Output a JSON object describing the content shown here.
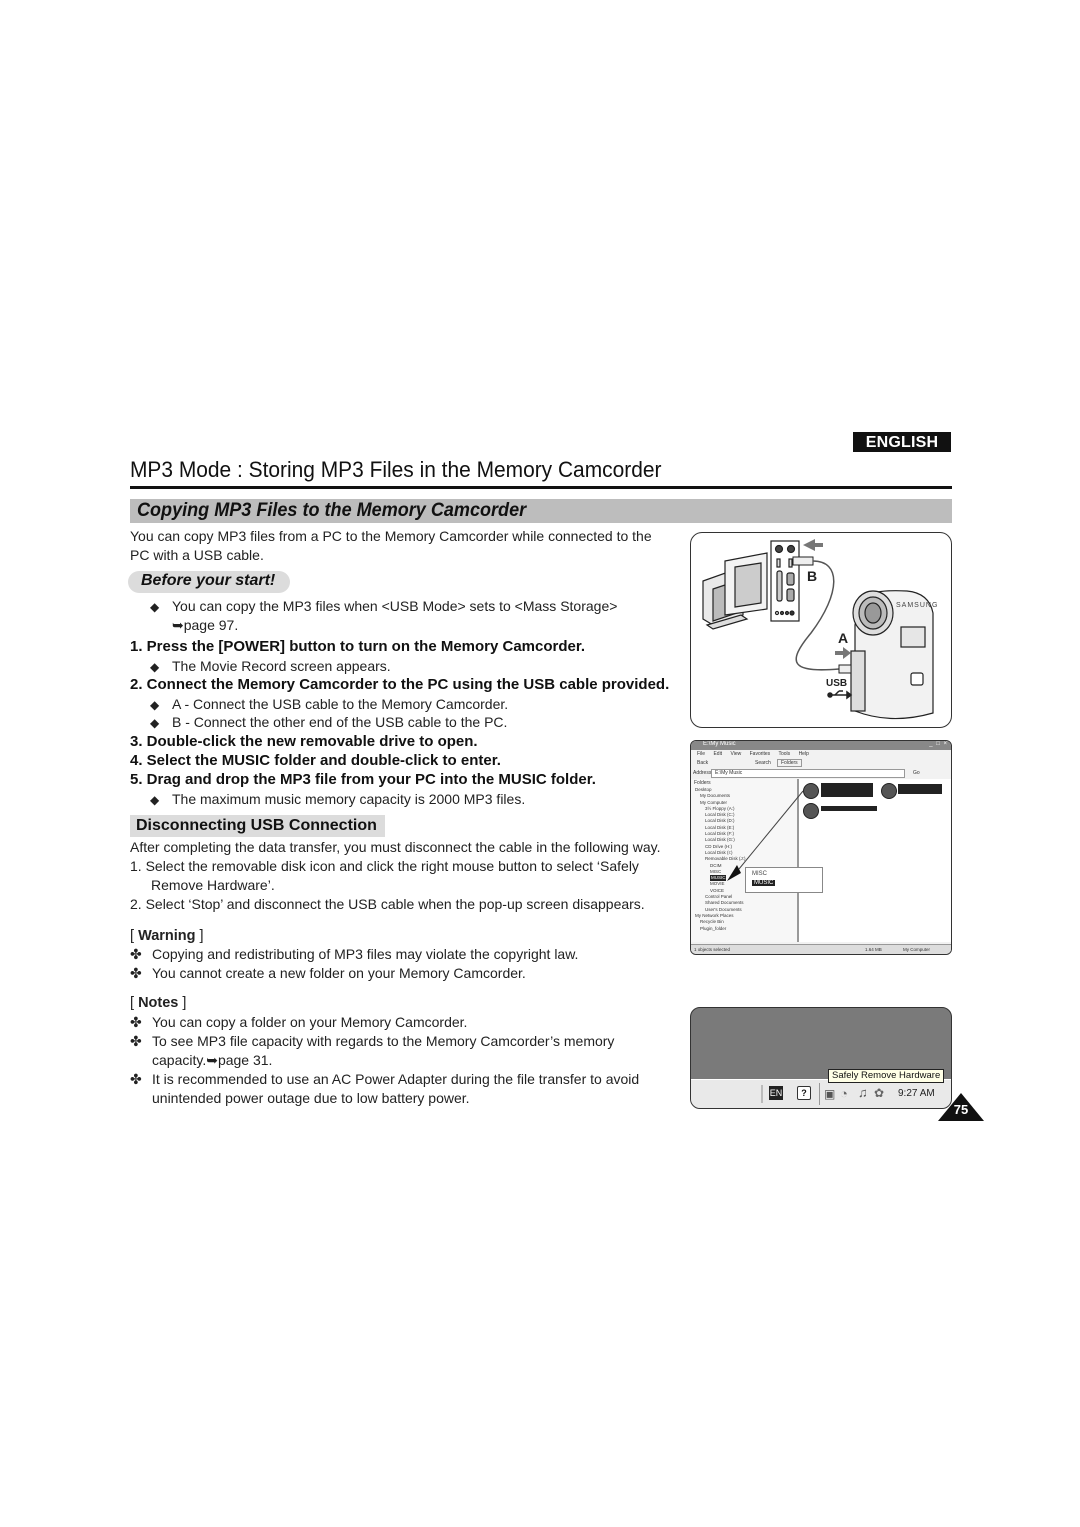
{
  "header": {
    "language_badge": "ENGLISH",
    "page_title": "MP3 Mode : Storing MP3 Files in the Memory Camcorder",
    "section_title": "Copying MP3 Files to the Memory Camcorder"
  },
  "intro": {
    "line1": "You can copy MP3 files from a PC to the Memory Camcorder while connected to the",
    "line2": "PC with a USB cable."
  },
  "before_start": {
    "label": "Before your start!",
    "bullet_line1": "You can copy the MP3 files when <USB Mode> sets to <Mass Storage>",
    "bullet_line2": "➥page 97."
  },
  "steps": [
    {
      "text": "1.  Press the [POWER] button to turn on the Memory Camcorder.",
      "bullets": [
        "The Movie Record screen appears."
      ]
    },
    {
      "text": "2.  Connect the Memory Camcorder to the PC using the USB cable provided.",
      "bullets": [
        "A - Connect the USB cable to the Memory Camcorder.",
        "B - Connect the other end of the USB cable to the PC."
      ]
    },
    {
      "text": "3.  Double-click the new removable drive to open.",
      "bullets": []
    },
    {
      "text": "4.  Select the MUSIC folder and double-click to enter.",
      "bullets": []
    },
    {
      "text": "5.  Drag and drop the MP3 file from your PC into the MUSIC folder.",
      "bullets": [
        "The maximum music memory capacity is 2000 MP3 files."
      ]
    }
  ],
  "disconnect": {
    "heading": "Disconnecting USB Connection",
    "intro": "After completing the data transfer, you must disconnect the cable in the following way.",
    "item1_line1": "1.  Select the removable disk icon and click the right mouse button to select ‘Safely",
    "item1_line2": "Remove Hardware’.",
    "item2": "2.  Select ‘Stop’ and disconnect the USB cable when the pop-up screen disappears."
  },
  "warning": {
    "heading_open": "[ ",
    "heading": "Warning",
    "heading_close": " ]",
    "items": [
      "Copying and redistributing of MP3 files may violate the copyright law.",
      "You cannot create a new folder on your Memory Camcorder."
    ]
  },
  "notes": {
    "heading_open": "[ ",
    "heading": "Notes",
    "heading_close": " ]",
    "item1": "You can copy a folder on your Memory Camcorder.",
    "item2_line1": "To see MP3 file capacity with regards to the Memory Camcorder’s memory",
    "item2_line2": "capacity.➥page 31.",
    "item3_line1": "It is recommended to use an AC Power Adapter during the file transfer to avoid",
    "item3_line2": "unintended power outage due to low battery power."
  },
  "figure_connection": {
    "label_a": "A",
    "label_b": "B",
    "usb_label": "USB",
    "brand": "SAMSUNG"
  },
  "figure_explorer": {
    "window_title": "E:\\My Music",
    "menu": [
      "File",
      "Edit",
      "View",
      "Favorites",
      "Tools",
      "Help"
    ],
    "toolbar": [
      "Back",
      "Search",
      "Folders"
    ],
    "address_label": "Address",
    "address_value": "E:\\My Music",
    "go_label": "Go",
    "folders_label": "Folders",
    "tree": [
      "Desktop",
      "My Documents",
      "My Computer",
      "3½ Floppy (A:)",
      "Local Disk (C:)",
      "Local Disk (D:)",
      "Local Disk (E:)",
      "Local Disk (F:)",
      "Local Disk (G:)",
      "CD Drive (H:)",
      "Local Disk (I:)",
      "Removable Disk (J:)",
      "DCIM",
      "MISC",
      "MUSIC",
      "MOVIE",
      "VOICE",
      "Control Panel",
      "Shared Documents",
      "User's Documents",
      "My Network Places",
      "Recycle Bin",
      "Plugin_folder"
    ],
    "popup_items": [
      "MISC",
      "MUSIC"
    ],
    "status_left": "1 objects selected",
    "status_size": "1.64 MB",
    "status_right": "My Computer"
  },
  "figure_taskbar": {
    "tooltip": "Safely Remove Hardware",
    "lang": "EN",
    "help": "?",
    "clock": "9:27 AM"
  },
  "page_number": "75"
}
